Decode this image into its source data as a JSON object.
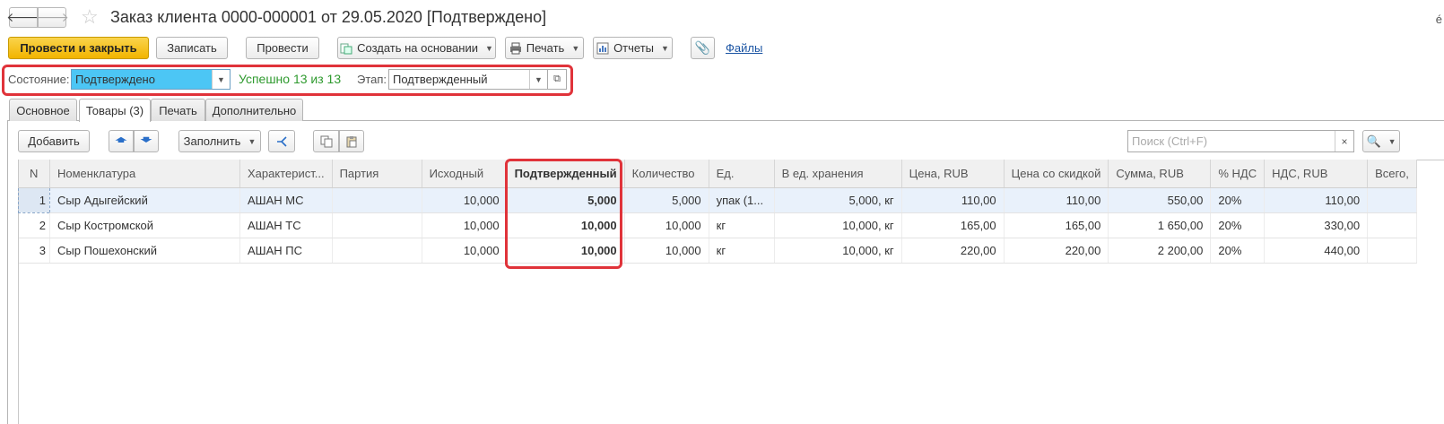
{
  "window": {
    "title": "Заказ клиента 0000-000001 от 29.05.2020 [Подтверждено]",
    "corner_char": "é"
  },
  "nav": {
    "back_icon": "arrow-left-icon",
    "forward_icon": "arrow-right-icon",
    "favorite_icon": "star-icon"
  },
  "toolbar": {
    "post_close": "Провести и закрыть",
    "save": "Записать",
    "post": "Провести",
    "create_based": "Создать на основании",
    "print": "Печать",
    "reports": "Отчеты",
    "files_link": "Файлы"
  },
  "state": {
    "label": "Состояние:",
    "value": "Подтверждено",
    "success_text": "Успешно 13 из 13",
    "stage_label": "Этап:",
    "stage_value": "Подтвержденный"
  },
  "tabs": [
    "Основное",
    "Товары (3)",
    "Печать",
    "Дополнительно"
  ],
  "active_tab": 1,
  "items_toolbar": {
    "add": "Добавить",
    "fill": "Заполнить",
    "search_placeholder": "Поиск (Ctrl+F)",
    "search_clear": "×",
    "search_icon": "magnifier-icon"
  },
  "table": {
    "headers": [
      "N",
      "Номенклатура",
      "Характерист...",
      "Партия",
      "Исходный",
      "Подтвержденный",
      "Количество",
      "Ед.",
      "В ед. хранения",
      "Цена, RUB",
      "Цена со скидкой",
      "Сумма, RUB",
      "% НДС",
      "НДС, RUB",
      "Всего,"
    ],
    "rows": [
      [
        "1",
        "Сыр Адыгейский",
        "АШАН МС",
        "",
        "10,000",
        "5,000",
        "5,000",
        "упак (1...",
        "5,000, кг",
        "110,00",
        "110,00",
        "550,00",
        "20%",
        "110,00",
        ""
      ],
      [
        "2",
        "Сыр Костромской",
        "АШАН ТС",
        "",
        "10,000",
        "10,000",
        "10,000",
        "кг",
        "10,000, кг",
        "165,00",
        "165,00",
        "1 650,00",
        "20%",
        "330,00",
        ""
      ],
      [
        "3",
        "Сыр Пошехонский",
        "АШАН ПС",
        "",
        "10,000",
        "10,000",
        "10,000",
        "кг",
        "10,000, кг",
        "220,00",
        "220,00",
        "2 200,00",
        "20%",
        "440,00",
        ""
      ]
    ]
  },
  "colors": {
    "primary": "#f5be14",
    "selected_state": "#4cc6f5",
    "success": "#2e9a2e",
    "highlight_frame": "#e0333a",
    "link": "#1b54a3"
  }
}
